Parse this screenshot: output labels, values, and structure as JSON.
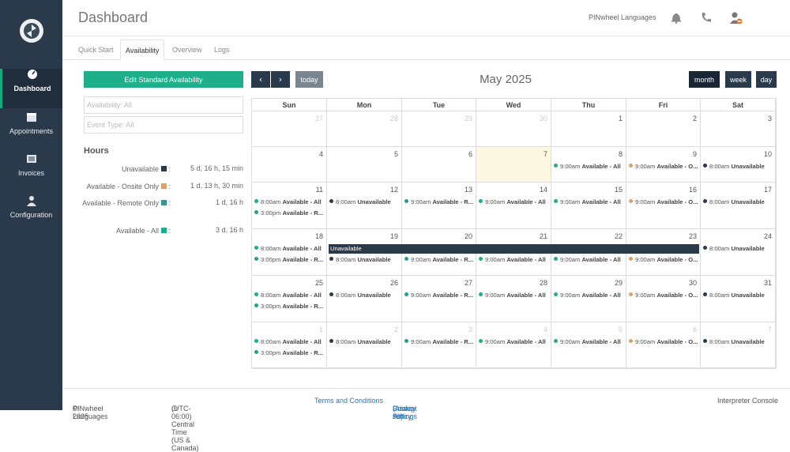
{
  "sidebar": {
    "items": [
      {
        "label": "Dashboard",
        "icon": "dashboard-gauge-icon"
      },
      {
        "label": "Appointments",
        "icon": "calendar-icon"
      },
      {
        "label": "Invoices",
        "icon": "invoice-icon"
      },
      {
        "label": "Configuration",
        "icon": "user-config-icon"
      }
    ]
  },
  "header": {
    "title": "Dashboard",
    "org": "PINwheel Languages",
    "icons": [
      "bell-icon",
      "phone-icon",
      "user-status-icon"
    ]
  },
  "tabs": [
    "Quick Start",
    "Availability",
    "Overview",
    "Logs"
  ],
  "left": {
    "edit_button": "Edit Standard Availability",
    "availability_filter": "Availability: All",
    "event_type_filter": "Event Type: All",
    "hours_title": "Hours",
    "hours": [
      {
        "label": "Unavailable",
        "value": "5 d, 16 h, 15 min",
        "color": "#2b3a4b"
      },
      {
        "label": "Available - Onsite Only",
        "value": "1 d, 13 h, 30 min",
        "color": "#d4a373"
      },
      {
        "label": "Available - Remote Only",
        "value": "1 d, 16 h",
        "color": "#2a9d8f"
      },
      {
        "label": "Available - All",
        "value": "3 d, 16 h",
        "color": "#1fae8a"
      }
    ]
  },
  "calendar": {
    "prev": "‹",
    "next": "›",
    "today_button": "today",
    "month_label": "May 2025",
    "views": [
      "month",
      "week",
      "day"
    ],
    "active_view": "month",
    "weekdays": [
      "Sun",
      "Mon",
      "Tue",
      "Wed",
      "Thu",
      "Fri",
      "Sat"
    ],
    "weeks": [
      [
        {
          "d": "27",
          "o": true
        },
        {
          "d": "28",
          "o": true
        },
        {
          "d": "29",
          "o": true
        },
        {
          "d": "30",
          "o": true
        },
        {
          "d": "1"
        },
        {
          "d": "2"
        },
        {
          "d": "3"
        }
      ],
      [
        {
          "d": "4"
        },
        {
          "d": "5"
        },
        {
          "d": "6"
        },
        {
          "d": "7",
          "today": true
        },
        {
          "d": "8",
          "ev": [
            [
              "9:00am",
              "Available - All",
              "all"
            ]
          ]
        },
        {
          "d": "9",
          "ev": [
            [
              "9:00am",
              "Available - O...",
              "onsite"
            ]
          ]
        },
        {
          "d": "10",
          "ev": [
            [
              "8:00am",
              "Unavailable",
              "unav"
            ]
          ]
        }
      ],
      [
        {
          "d": "11",
          "ev": [
            [
              "8:00am",
              "Available - All",
              "all"
            ],
            [
              "3:00pm",
              "Available - R...",
              "remote"
            ]
          ]
        },
        {
          "d": "12",
          "ev": [
            [
              "8:00am",
              "Unavailable",
              "unav"
            ]
          ]
        },
        {
          "d": "13",
          "ev": [
            [
              "9:00am",
              "Available - R...",
              "remote"
            ]
          ]
        },
        {
          "d": "14",
          "ev": [
            [
              "9:00am",
              "Available - All",
              "all"
            ]
          ]
        },
        {
          "d": "15",
          "ev": [
            [
              "9:00am",
              "Available - All",
              "all"
            ]
          ]
        },
        {
          "d": "16",
          "ev": [
            [
              "9:00am",
              "Available - O...",
              "onsite"
            ]
          ]
        },
        {
          "d": "17",
          "ev": [
            [
              "8:00am",
              "Unavailable",
              "unav"
            ]
          ]
        }
      ],
      [
        {
          "d": "18",
          "ev": [
            [
              "8:00am",
              "Available - All",
              "all"
            ],
            [
              "3:00pm",
              "Available - R...",
              "remote"
            ]
          ]
        },
        {
          "d": "19",
          "ev": [
            [
              "8:00am",
              "Unavailable",
              "unav"
            ]
          ]
        },
        {
          "d": "20",
          "ev": [
            [
              "9:00am",
              "Available - R...",
              "remote"
            ]
          ]
        },
        {
          "d": "21",
          "ev": [
            [
              "9:00am",
              "Available - All",
              "all"
            ]
          ]
        },
        {
          "d": "22",
          "ev": [
            [
              "9:00am",
              "Available - All",
              "all"
            ]
          ]
        },
        {
          "d": "23",
          "ev": [
            [
              "9:00am",
              "Available - O...",
              "onsite"
            ]
          ]
        },
        {
          "d": "24",
          "ev": [
            [
              "8:00am",
              "Unavailable",
              "unav"
            ]
          ]
        }
      ],
      [
        {
          "d": "25",
          "ev": [
            [
              "8:00am",
              "Available - All",
              "all"
            ],
            [
              "3:00pm",
              "Available - R...",
              "remote"
            ]
          ]
        },
        {
          "d": "26",
          "ev": [
            [
              "8:00am",
              "Unavailable",
              "unav"
            ]
          ]
        },
        {
          "d": "27",
          "ev": [
            [
              "9:00am",
              "Available - R...",
              "remote"
            ]
          ]
        },
        {
          "d": "28",
          "ev": [
            [
              "9:00am",
              "Available - All",
              "all"
            ]
          ]
        },
        {
          "d": "29",
          "ev": [
            [
              "9:00am",
              "Available - All",
              "all"
            ]
          ]
        },
        {
          "d": "30",
          "ev": [
            [
              "9:00am",
              "Available - O...",
              "onsite"
            ]
          ]
        },
        {
          "d": "31",
          "ev": [
            [
              "8:00am",
              "Unavailable",
              "unav"
            ]
          ]
        }
      ],
      [
        {
          "d": "1",
          "o": true,
          "ev": [
            [
              "8:00am",
              "Available - All",
              "all"
            ],
            [
              "3:00pm",
              "Available - R...",
              "remote"
            ]
          ]
        },
        {
          "d": "2",
          "o": true,
          "ev": [
            [
              "8:00am",
              "Unavailable",
              "unav"
            ]
          ]
        },
        {
          "d": "3",
          "o": true,
          "ev": [
            [
              "9:00am",
              "Available - R...",
              "remote"
            ]
          ]
        },
        {
          "d": "4",
          "o": true,
          "ev": [
            [
              "9:00am",
              "Available - All",
              "all"
            ]
          ]
        },
        {
          "d": "5",
          "o": true,
          "ev": [
            [
              "9:00am",
              "Available - All",
              "all"
            ]
          ]
        },
        {
          "d": "6",
          "o": true,
          "ev": [
            [
              "9:00am",
              "Available - O...",
              "onsite"
            ]
          ]
        },
        {
          "d": "7",
          "o": true,
          "ev": [
            [
              "8:00am",
              "Unavailable",
              "unav"
            ]
          ]
        }
      ]
    ],
    "allday_event": {
      "label": "Unavailable",
      "week": 3,
      "from_day": 1,
      "to_day": 5
    },
    "colors": {
      "all": "#1fae8a",
      "onsite": "#d4a373",
      "remote": "#2a9d8f",
      "unav": "#2b3a4b"
    }
  },
  "footer": {
    "brand": "PINwheel Languages",
    "copyright": "© 2025",
    "timezone": "(UTC-06:00) Central Time (US & Canada)",
    "terms": "Terms and Conditions",
    "privacy": "Privacy Policy",
    "cookies": "Cookie settings",
    "accept": "(Accept All)",
    "console": "Interpreter Console"
  }
}
